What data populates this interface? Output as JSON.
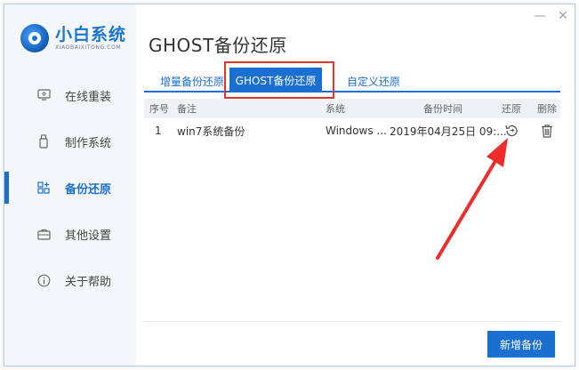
{
  "app": {
    "name": "小白系统",
    "subtitle": "XIAOBAIXITONG.COM"
  },
  "window_controls": {
    "minimize": "—",
    "close": "✕"
  },
  "sidebar": {
    "items": [
      {
        "label": "在线重装",
        "icon": "monitor-icon",
        "active": false
      },
      {
        "label": "制作系统",
        "icon": "usb-icon",
        "active": false
      },
      {
        "label": "备份还原",
        "icon": "backup-icon",
        "active": true
      },
      {
        "label": "其他设置",
        "icon": "briefcase-icon",
        "active": false
      },
      {
        "label": "关于帮助",
        "icon": "info-icon",
        "active": false
      }
    ]
  },
  "main": {
    "title": "GHOST备份还原",
    "tabs": [
      {
        "label": "增量备份还原",
        "active": false
      },
      {
        "label": "GHOST备份还原",
        "active": true
      },
      {
        "label": "自定义还原",
        "active": false
      }
    ],
    "table": {
      "headers": {
        "no": "序号",
        "note": "备注",
        "system": "系统",
        "time": "备份时间",
        "restore": "还原",
        "delete": "删除"
      },
      "rows": [
        {
          "no": "1",
          "note": "win7系统备份",
          "system": "Windows ...",
          "time": "2019年04月25日 09:..."
        }
      ]
    },
    "new_backup_label": "新增备份"
  },
  "colors": {
    "accent": "#1a6fd0",
    "highlight": "#e0342c",
    "sidebar_bg": "#f4f7fa"
  }
}
